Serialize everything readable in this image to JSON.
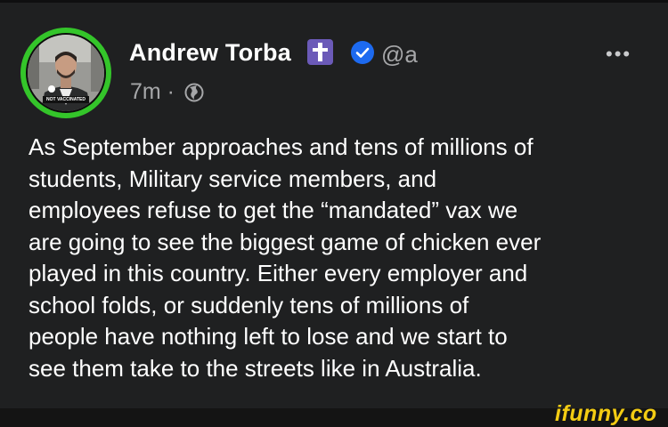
{
  "colors": {
    "background": "#1f2021",
    "text_primary": "#ffffff",
    "text_secondary": "#a6a7a9",
    "verified_blue": "#1d6af0",
    "cross_badge": "#6b5ab8",
    "avatar_ring": "#34c52a",
    "watermark": "#f3cc13"
  },
  "author": {
    "name": "Andrew Torba",
    "handle": "@a",
    "badge_icon": "cross-icon",
    "verified_icon": "verified-check-icon",
    "avatar_caption": "NOT VACCINATED"
  },
  "meta": {
    "time": "7m · ",
    "visibility_icon": "globe-icon"
  },
  "menu": {
    "more_label": "•••",
    "icon": "more-options-icon"
  },
  "post": {
    "text": "As September approaches and tens of millions of\nstudents, Military service members, and\nemployees refuse to get the “mandated” vax we\nare going to see the biggest game of chicken ever\nplayed in this country. Either every employer and\nschool folds, or suddenly tens of millions of\npeople have nothing left to lose and we start to\nsee them take to the streets like in Australia."
  },
  "watermark": {
    "text": "ifunny.co"
  }
}
